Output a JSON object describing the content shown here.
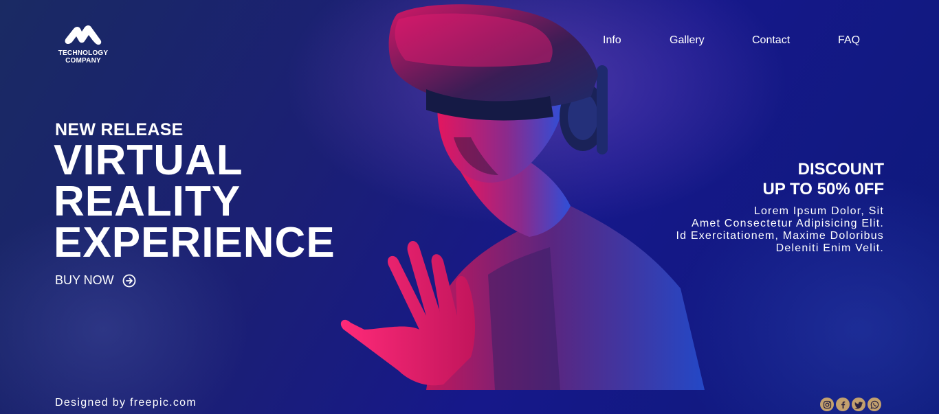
{
  "brand": {
    "logo_line1": "TECHNOLOGY",
    "logo_line2": "COMPANY"
  },
  "nav": {
    "info": "Info",
    "gallery": "Gallery",
    "contact": "Contact",
    "faq": "FAQ"
  },
  "hero": {
    "eyebrow": "NEW RELEASE",
    "headline_line1": "VIRTUAL",
    "headline_line2": "REALITY",
    "headline_line3": "EXPERIENCE",
    "cta_label": "BUY NOW",
    "cta_icon": "arrow-right-circle-icon"
  },
  "discount": {
    "title_line1": "DISCOUNT",
    "title_line2": "UP TO 50% 0FF",
    "body_line1": "Lorem Ipsum Dolor, Sit",
    "body_line2": "Amet Consectetur Adipisicing Elit.",
    "body_line3": "Id Exercitationem, Maxime Doloribus",
    "body_line4": "Deleniti Enim Velit."
  },
  "footer": {
    "credit": "Designed by freepic.com",
    "socials": [
      "instagram-icon",
      "facebook-icon",
      "twitter-icon",
      "whatsapp-icon"
    ]
  },
  "colors": {
    "background": "#1b1f75",
    "accent_magenta": "#e0196e",
    "accent_blue": "#2b48d6",
    "social_gold": "#c3a06e"
  }
}
